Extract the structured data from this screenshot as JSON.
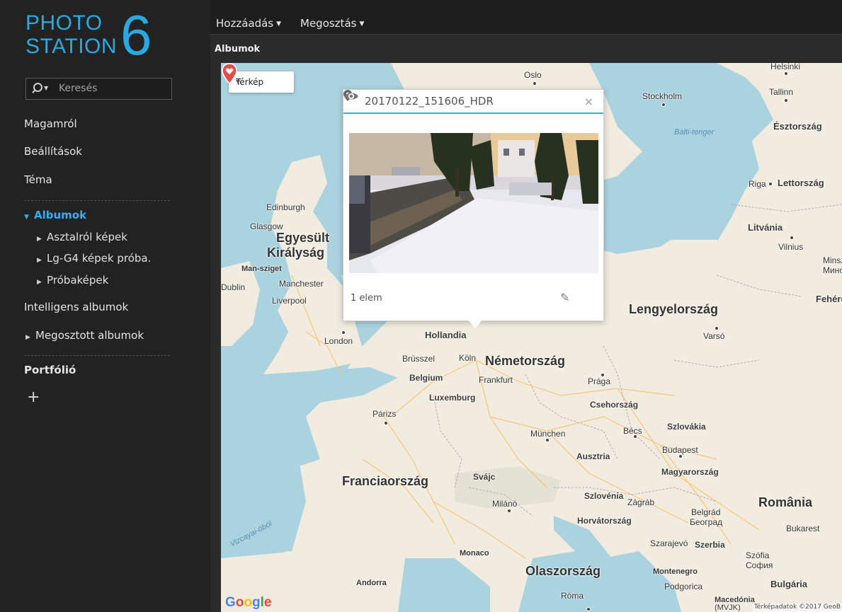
{
  "logo": {
    "line1": "PHOTO",
    "line2": "STATION",
    "number": "6"
  },
  "search": {
    "placeholder": "Keresés"
  },
  "sidebar": {
    "items": [
      {
        "label": "Magamról"
      },
      {
        "label": "Beállítások"
      },
      {
        "label": "Téma"
      }
    ],
    "albums": {
      "label": "Albumok",
      "children": [
        {
          "label": "Asztalról képek"
        },
        {
          "label": "Lg-G4 képek próba."
        },
        {
          "label": "Próbaképek"
        }
      ]
    },
    "smart_albums": "Intelligens albumok",
    "shared_albums": "Megosztott albumok",
    "portfolio": "Portfólió",
    "add": "+"
  },
  "topbar": {
    "add_label": "Hozzáadás",
    "share_label": "Megosztás"
  },
  "breadcrumb": "Albumok",
  "map": {
    "type_selector": "Térkép",
    "popup": {
      "title": "20170122_151606_HDR",
      "count": "1 elem",
      "close": "×"
    },
    "countries": {
      "uk": "Egyesült",
      "uk2": "Királyság",
      "germany": "Németország",
      "france": "Franciaország",
      "poland": "Lengyelország",
      "italy": "Olaszország",
      "romania": "România",
      "estonia": "Észtország",
      "latvia": "Lettország",
      "lithuania": "Litvánia",
      "belarus": "Fehérorosz",
      "netherlands": "Hollandia",
      "belgium": "Belgium",
      "luxembourg": "Luxemburg",
      "czech": "Csehország",
      "slovakia": "Szlovákia",
      "austria": "Ausztria",
      "hungary": "Magyarország",
      "switzerland": "Svájc",
      "slovenia": "Szlovénia",
      "croatia": "Horvátország",
      "serbia": "Szerbia",
      "bulgaria": "Bulgária",
      "montenegro": "Montenegro",
      "andorra": "Andorra",
      "monaco": "Monaco",
      "isle_of_man": "Man-sziget",
      "macedonia": "Macedónia",
      "mvjk": "(MVJK)"
    },
    "cities": {
      "oslo": "Oslo",
      "stockholm": "Stockholm",
      "helsinki": "Helsinki",
      "tallinn": "Tallinn",
      "riga": "Riga",
      "vilnius": "Vilnius",
      "minsk": "Minsz",
      "edinburgh": "Edinburgh",
      "glasgow": "Glasgow",
      "dublin": "Dublin",
      "manchester": "Manchester",
      "liverpool": "Liverpool",
      "london": "London",
      "brussels": "Brüsszel",
      "koln": "Köln",
      "frankfurt": "Frankfurt",
      "paris": "Párizs",
      "prague": "Prága",
      "warsaw": "Varsó",
      "munich": "München",
      "vienna": "Bécs",
      "budapest": "Budapest",
      "milan": "Milánó",
      "zagreb": "Zágráb",
      "belgrade": "Belgrád",
      "belgrade_cyr": "Београд",
      "bucharest": "Bukarest",
      "sarajevo": "Szarajevó",
      "sofia": "Szófia",
      "sofia_cyr": "София",
      "podgorica": "Podgorica",
      "rome": "Róma",
      "minsk_cyr": "Минск"
    },
    "seas": {
      "baltic": "Balti-tenger",
      "biscay": "Vizcayai-öböl"
    },
    "google": "Google",
    "attribution": "Térképadatok ©2017 GeoB"
  }
}
